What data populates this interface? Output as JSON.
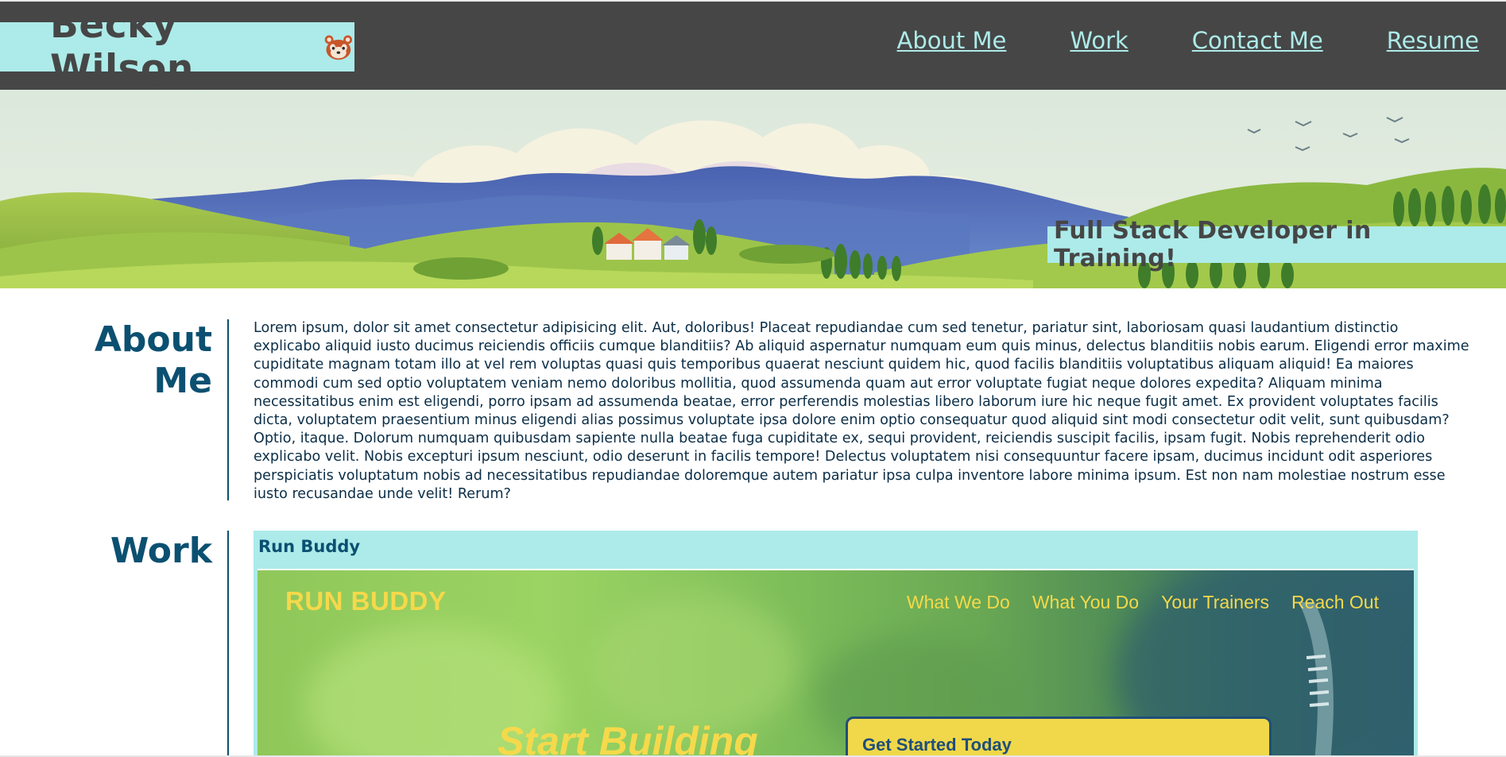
{
  "header": {
    "brand_name": "Becky Wilson",
    "brand_icon": "red-panda-icon",
    "nav": [
      "About Me",
      "Work",
      "Contact Me",
      "Resume"
    ]
  },
  "hero": {
    "tagline": "Full Stack Developer in Training!"
  },
  "about": {
    "title_line1": "About",
    "title_line2": "Me",
    "body": "Lorem ipsum, dolor sit amet consectetur adipisicing elit. Aut, doloribus! Placeat repudiandae cum sed tenetur, pariatur sint, laboriosam quasi laudantium distinctio explicabo aliquid iusto ducimus reiciendis officiis cumque blanditiis? Ab aliquid aspernatur numquam eum quis minus, delectus blanditiis nobis earum. Eligendi error maxime cupiditate magnam totam illo at vel rem voluptas quasi quis temporibus quaerat nesciunt quidem hic, quod facilis blanditiis voluptatibus aliquam aliquid! Ea maiores commodi cum sed optio voluptatem veniam nemo doloribus mollitia, quod assumenda quam aut error voluptate fugiat neque dolores expedita? Aliquam minima necessitatibus enim est eligendi, porro ipsam ad assumenda beatae, error perferendis molestias libero laborum iure hic neque fugit amet. Ex provident voluptates facilis dicta, voluptatem praesentium minus eligendi alias possimus voluptate ipsa dolore enim optio consequatur quod aliquid sint modi consectetur odit velit, sunt quibusdam? Optio, itaque. Dolorum numquam quibusdam sapiente nulla beatae fuga cupiditate ex, sequi provident, reiciendis suscipit facilis, ipsam fugit. Nobis reprehenderit odio explicabo velit. Nobis excepturi ipsum nesciunt, odio deserunt in facilis tempore! Delectus voluptatem nisi consequuntur facere ipsam, ducimus incidunt odit asperiores perspiciatis voluptatum nobis ad necessitatibus repudiandae doloremque autem pariatur ipsa culpa inventore labore minima ipsum. Est non nam molestiae nostrum esse iusto recusandae unde velit! Rerum?"
  },
  "work": {
    "title": "Work",
    "card_title": "Run Buddy",
    "screenshot": {
      "logo": "RUN BUDDY",
      "nav": [
        "What We Do",
        "What You Do",
        "Your Trainers",
        "Reach Out"
      ],
      "hero_text": "Start Building",
      "form_title": "Get Started Today"
    }
  },
  "colors": {
    "header_bg": "#464646",
    "accent": "#acebe9",
    "heading": "#0b5071",
    "runbuddy_yellow": "#f5d94b"
  }
}
